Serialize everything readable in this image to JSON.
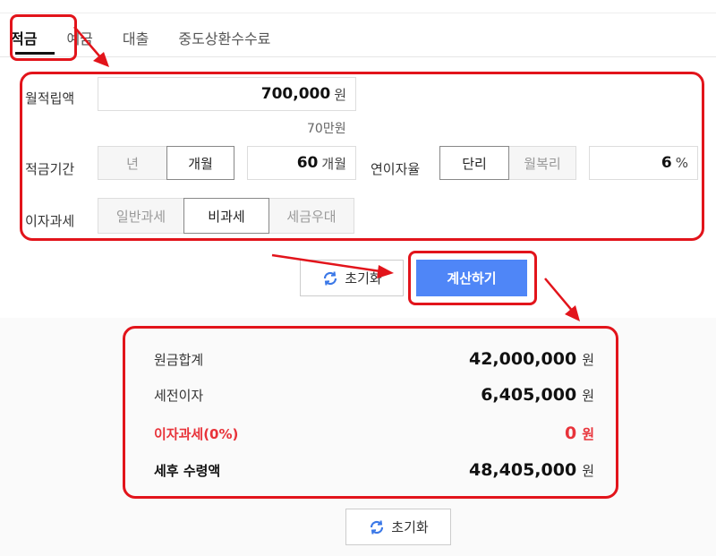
{
  "tabs": [
    {
      "label": "적금",
      "active": true
    },
    {
      "label": "예금",
      "active": false
    },
    {
      "label": "대출",
      "active": false
    },
    {
      "label": "중도상환수수료",
      "active": false
    }
  ],
  "form": {
    "monthly_label": "월적립액",
    "monthly_value": "700,000",
    "monthly_unit": "원",
    "monthly_hint": "70만원",
    "period_label": "적금기간",
    "period_options": [
      "년",
      "개월"
    ],
    "period_selected": "개월",
    "period_value": "60",
    "period_unit": "개월",
    "rate_label": "연이자율",
    "rate_options": [
      "단리",
      "월복리"
    ],
    "rate_selected": "단리",
    "rate_value": "6",
    "rate_unit": "%",
    "tax_label": "이자과세",
    "tax_options": [
      "일반과세",
      "비과세",
      "세금우대"
    ],
    "tax_selected": "비과세"
  },
  "buttons": {
    "reset_label": "초기화",
    "calc_label": "계산하기"
  },
  "results": {
    "principal_label": "원금합계",
    "principal_value": "42,000,000",
    "pretax_interest_label": "세전이자",
    "pretax_interest_value": "6,405,000",
    "tax_label": "이자과세(0%)",
    "tax_value": "0",
    "net_label": "세후 수령액",
    "net_value": "48,405,000",
    "unit": "원"
  },
  "colors": {
    "highlight": "#e2141b",
    "primary_button": "#4f86f7",
    "tax_text": "#e8333a"
  }
}
